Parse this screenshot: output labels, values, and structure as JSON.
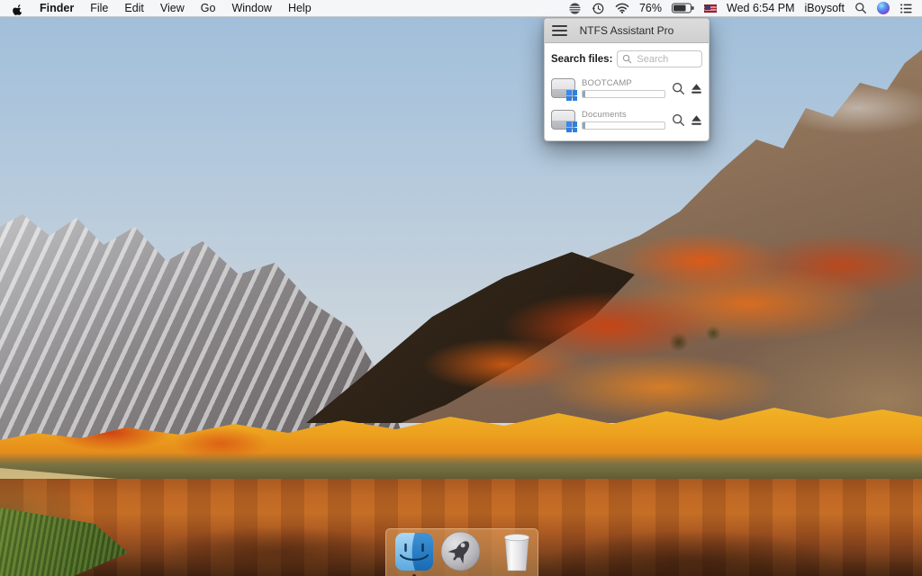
{
  "menu_bar": {
    "left_items": [
      {
        "label": "Finder",
        "bold": true
      },
      {
        "label": "File"
      },
      {
        "label": "Edit"
      },
      {
        "label": "View"
      },
      {
        "label": "Go"
      },
      {
        "label": "Window"
      },
      {
        "label": "Help"
      }
    ],
    "status": {
      "battery_percent": "76%",
      "clock": "Wed 6:54 PM",
      "app_menu_label": "iBoysoft"
    },
    "status_icons": [
      "iboysoft-drive-icon",
      "time-machine-icon",
      "wifi-icon",
      "battery-icon",
      "input-source-us-flag",
      "spotlight-icon",
      "siri-icon",
      "notification-center-icon"
    ]
  },
  "panel": {
    "title": "NTFS Assistant Pro",
    "search_label": "Search files:",
    "search_placeholder": "Search",
    "drives": [
      {
        "name": "BOOTCAMP",
        "usage_percent": 3
      },
      {
        "name": "Documents",
        "usage_percent": 3
      }
    ]
  },
  "dock": {
    "items": [
      {
        "name": "Finder",
        "running": true
      },
      {
        "name": "Launchpad",
        "running": false
      },
      {
        "name": "Trash",
        "running": false
      }
    ]
  },
  "colors": {
    "windows_logo_blue": "#2e7fe0",
    "menu_bar_bg": "#f8f8f9",
    "panel_header_bg": "#d6d6d6",
    "foliage_orange": "#e06a1a",
    "lake_orange": "#bc6423"
  }
}
